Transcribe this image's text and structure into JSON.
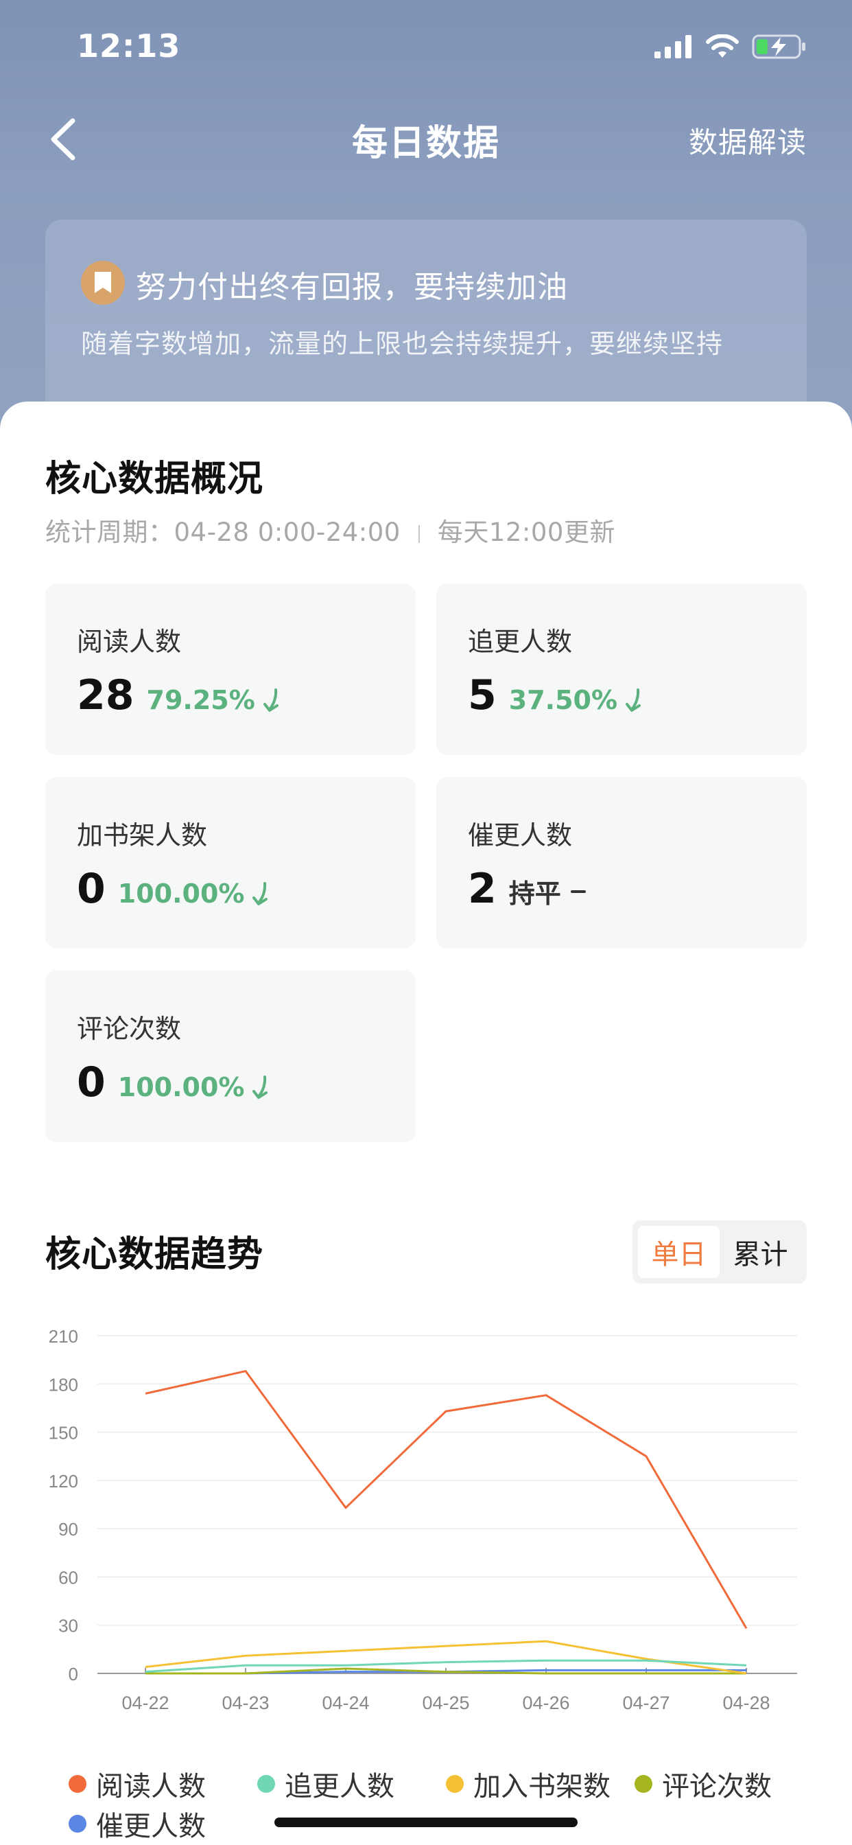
{
  "status": {
    "time": "12:13"
  },
  "nav": {
    "title": "每日数据",
    "action": "数据解读"
  },
  "tip": {
    "title": "努力付出终有回报，要持续加油",
    "subtitle": "随着字数增加，流量的上限也会持续提升，要继续坚持"
  },
  "overview": {
    "title": "核心数据概况",
    "period_label": "统计周期：04-28 0:00-24:00",
    "update_label": "每天12:00更新",
    "metrics": [
      {
        "label": "阅读人数",
        "value": "28",
        "change": "79.25%",
        "trend": "down"
      },
      {
        "label": "追更人数",
        "value": "5",
        "change": "37.50%",
        "trend": "down"
      },
      {
        "label": "加书架人数",
        "value": "0",
        "change": "100.00%",
        "trend": "down"
      },
      {
        "label": "催更人数",
        "value": "2",
        "change": "持平",
        "trend": "flat"
      },
      {
        "label": "评论次数",
        "value": "0",
        "change": "100.00%",
        "trend": "down"
      }
    ]
  },
  "trend": {
    "title": "核心数据趋势",
    "toggle": {
      "daily": "单日",
      "cumulative": "累计",
      "active": "daily"
    }
  },
  "colors": {
    "accent": "#f07b3f",
    "down": "#5cb27f",
    "read": "#f06a3a",
    "follow": "#6fd7b5",
    "shelf": "#f5c033",
    "comment": "#a5b520",
    "urge": "#5b86e5"
  },
  "chart_data": {
    "type": "line",
    "categories": [
      "04-22",
      "04-23",
      "04-24",
      "04-25",
      "04-26",
      "04-27",
      "04-28"
    ],
    "ylim": [
      0,
      210
    ],
    "yticks": [
      0,
      30,
      60,
      90,
      120,
      150,
      180,
      210
    ],
    "grid": true,
    "legend_position": "bottom",
    "series": [
      {
        "name": "阅读人数",
        "color": "#f06a3a",
        "values": [
          174,
          188,
          103,
          163,
          173,
          135,
          28
        ]
      },
      {
        "name": "追更人数",
        "color": "#6fd7b5",
        "values": [
          1,
          5,
          5,
          7,
          8,
          8,
          5
        ]
      },
      {
        "name": "加入书架数",
        "color": "#f5c033",
        "values": [
          4,
          11,
          14,
          17,
          20,
          9,
          0
        ]
      },
      {
        "name": "评论次数",
        "color": "#a5b520",
        "values": [
          0,
          0,
          3,
          1,
          0,
          0,
          0
        ]
      },
      {
        "name": "催更人数",
        "color": "#5b86e5",
        "values": [
          0,
          0,
          1,
          1,
          2,
          2,
          2
        ]
      }
    ]
  }
}
